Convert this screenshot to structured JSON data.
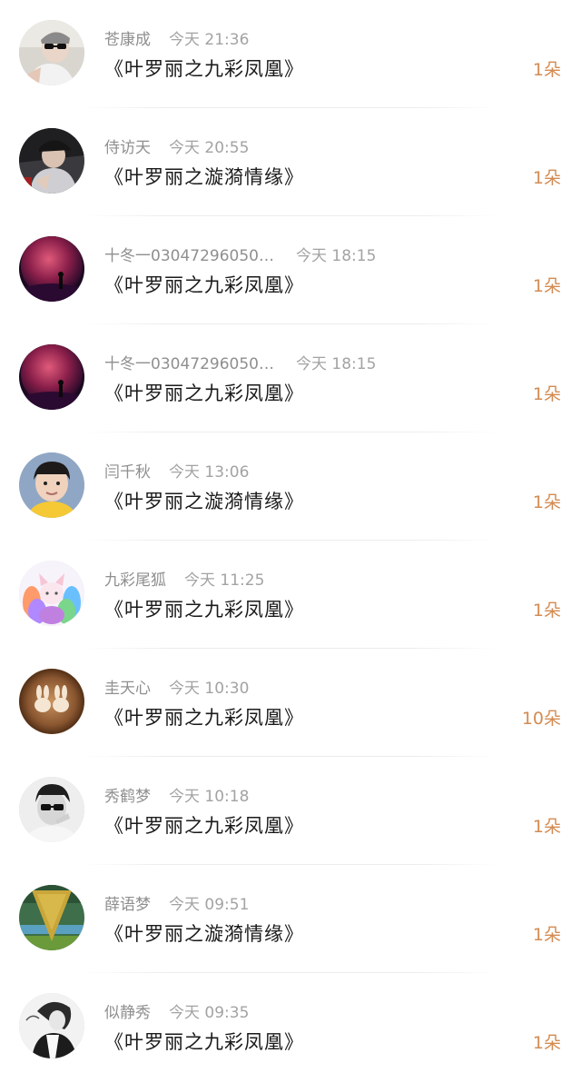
{
  "items": [
    {
      "name": "苍康成",
      "time": "今天 21:36",
      "title": "《叶罗丽之九彩凤凰》",
      "count": "1朵",
      "avatar": "avatar-man-sunglasses"
    },
    {
      "name": "侍访天",
      "time": "今天 20:55",
      "title": "《叶罗丽之漩漪情缘》",
      "count": "1朵",
      "avatar": "avatar-person-cap"
    },
    {
      "name": "十冬一03047296050…",
      "time": "今天 18:15",
      "title": "《叶罗丽之九彩凤凰》",
      "count": "1朵",
      "avatar": "avatar-planet-figure"
    },
    {
      "name": "十冬一03047296050…",
      "time": "今天 18:15",
      "title": "《叶罗丽之九彩凤凰》",
      "count": "1朵",
      "avatar": "avatar-planet-figure"
    },
    {
      "name": "闫千秋",
      "time": "今天 13:06",
      "title": "《叶罗丽之漩漪情缘》",
      "count": "1朵",
      "avatar": "avatar-child"
    },
    {
      "name": "九彩尾狐",
      "time": "今天 11:25",
      "title": "《叶罗丽之九彩凤凰》",
      "count": "1朵",
      "avatar": "avatar-nine-tailed-fox"
    },
    {
      "name": "圭天心",
      "time": "今天 10:30",
      "title": "《叶罗丽之九彩凤凰》",
      "count": "10朵",
      "avatar": "avatar-latte-art"
    },
    {
      "name": "秀鹤梦",
      "time": "今天 10:18",
      "title": "《叶罗丽之九彩凤凰》",
      "count": "1朵",
      "avatar": "avatar-man-sunglasses-bw"
    },
    {
      "name": "薛语梦",
      "time": "今天 09:51",
      "title": "《叶罗丽之漩漪情缘》",
      "count": "1朵",
      "avatar": "avatar-abstract-green"
    },
    {
      "name": "似静秀",
      "time": "今天 09:35",
      "title": "《叶罗丽之九彩凤凰》",
      "count": "1朵",
      "avatar": "avatar-sketch-figure"
    }
  ],
  "colors": {
    "accent": "#d38b52",
    "meta": "#9a9a9a",
    "title": "#1a1a1a"
  }
}
